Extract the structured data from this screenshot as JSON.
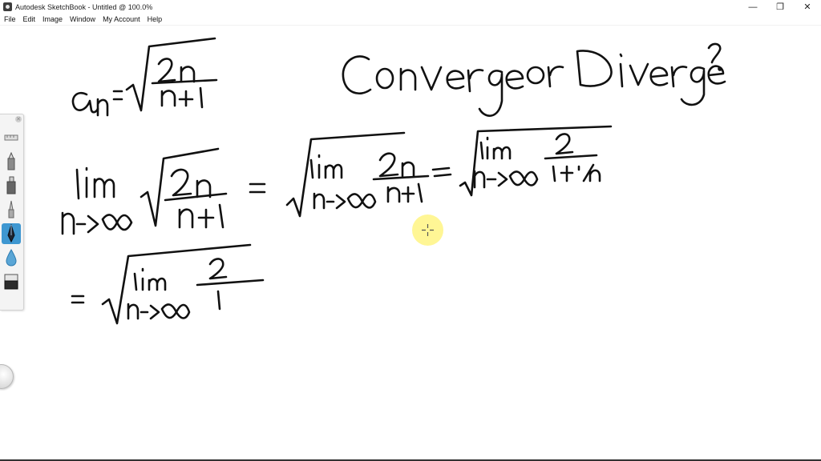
{
  "window": {
    "title": "Autodesk SketchBook - Untitled @ 100.0%",
    "controls": {
      "minimize": "—",
      "restore": "❐",
      "close": "✕"
    }
  },
  "menu": [
    "File",
    "Edit",
    "Image",
    "Window",
    "My Account",
    "Help"
  ],
  "tools": [
    {
      "name": "ruler-tool",
      "icon": "ruler-icon"
    },
    {
      "name": "pencil-tool",
      "icon": "pencil-icon"
    },
    {
      "name": "marker-tool",
      "icon": "marker-icon"
    },
    {
      "name": "airbrush-tool",
      "icon": "airbrush-icon"
    },
    {
      "name": "pen-tool",
      "icon": "pen-icon",
      "selected": true
    },
    {
      "name": "blur-tool",
      "icon": "blur-icon"
    },
    {
      "name": "eraser-tool",
      "icon": "eraser-icon"
    }
  ],
  "colors": {
    "accent": "#3e97d1",
    "cursor_highlight": "#fff582",
    "ink": "#111111"
  },
  "handwriting": {
    "sequence_definition": "a_n = √(2n/(n+1))",
    "question": "Converge or Diverge?",
    "step1": "lim n->∞ √(2n/(n+1)) = √(lim n->∞ 2n/(n+1)) = √(lim n->∞ 2/(1+1/n))",
    "step2": "= √(lim n->∞ 2/1)"
  }
}
